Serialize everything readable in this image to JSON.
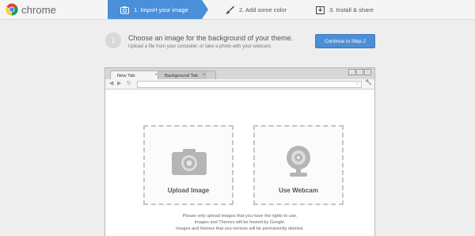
{
  "brand": {
    "name": "chrome"
  },
  "steps": [
    {
      "label": "1. Import your image",
      "icon": "camera-icon",
      "active": true
    },
    {
      "label": "2. Add some color",
      "icon": "paintbrush-icon",
      "active": false
    },
    {
      "label": "3. Install & share",
      "icon": "install-icon",
      "active": false
    }
  ],
  "instructions": {
    "step_number": "1",
    "title": "Choose an image for the background of your theme.",
    "subtitle": "Upload a file from your computer, or take a photo with your webcam."
  },
  "continue_button": "Continue to Step 2",
  "preview": {
    "tabs": [
      {
        "label": "New Tab",
        "close": "×"
      },
      {
        "label": "Background Tab",
        "close": "×"
      }
    ],
    "upload_label": "Upload Image",
    "webcam_label": "Use Webcam",
    "notice": [
      "Please only upload images that you have the rights to use.",
      "Images and Themes will be hosted by Google.",
      "Images and themes that you remove will be permanently deleted."
    ]
  },
  "colors": {
    "accent": "#4a90d9",
    "background": "#eeeeee"
  }
}
